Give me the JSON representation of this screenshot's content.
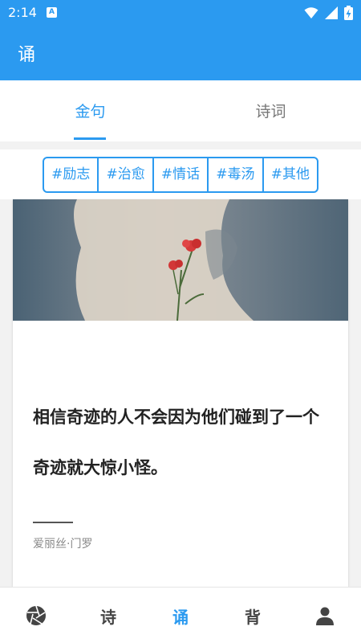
{
  "status_bar": {
    "time": "2:14",
    "notification_badge": "A",
    "icons": [
      "wifi-icon",
      "signal-icon",
      "battery-charging-icon"
    ]
  },
  "app_bar": {
    "title": "诵"
  },
  "tabs": [
    {
      "label": "金句",
      "active": true
    },
    {
      "label": "诗词",
      "active": false
    }
  ],
  "categories": [
    "#励志",
    "#治愈",
    "#情话",
    "#毒汤",
    "#其他"
  ],
  "card": {
    "image": "red-carnation-flower-shadow",
    "quote": "相信奇迹的人不会因为他们碰到了一个奇迹就大惊小怪。",
    "author": "爱丽丝·门罗"
  },
  "bottom_nav": [
    {
      "icon": "camera-shutter-icon",
      "label": ""
    },
    {
      "label": "诗"
    },
    {
      "label": "诵",
      "active": true
    },
    {
      "label": "背"
    },
    {
      "icon": "person-icon",
      "label": ""
    }
  ],
  "colors": {
    "primary": "#2b9af0",
    "text": "#222222",
    "muted": "#888888"
  }
}
